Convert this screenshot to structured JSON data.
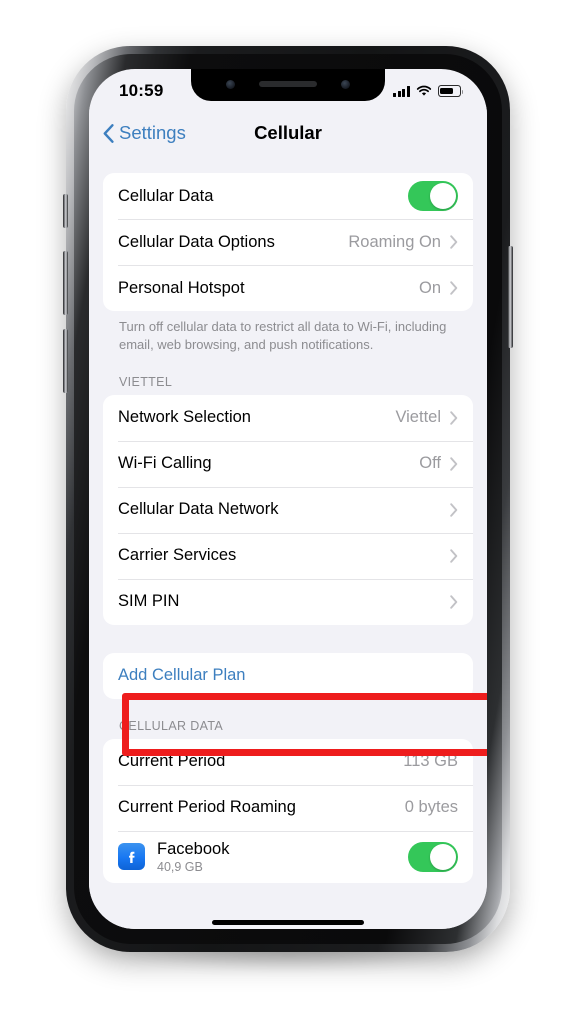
{
  "status_bar": {
    "time": "10:59",
    "signal_icon": "cellular-bars-icon",
    "wifi_icon": "wifi-icon",
    "battery_icon": "battery-icon",
    "battery_level_percent": 60
  },
  "nav": {
    "back_label": "Settings",
    "back_icon": "chevron-left-icon",
    "title": "Cellular"
  },
  "colors": {
    "accent_blue": "#3d7fbf",
    "toggle_green": "#34c759",
    "annotation_red": "#ee1d1d",
    "screen_background": "#f2f2f7",
    "card_background": "#ffffff",
    "secondary_text": "#8c8c90"
  },
  "sections": {
    "data_group": {
      "rows": [
        {
          "label": "Cellular Data",
          "control": "toggle",
          "toggle_on": true
        },
        {
          "label": "Cellular Data Options",
          "value": "Roaming On",
          "control": "chevron"
        },
        {
          "label": "Personal Hotspot",
          "value": "On",
          "control": "chevron"
        }
      ],
      "footnote": "Turn off cellular data to restrict all data to Wi-Fi, including email, web browsing, and push notifications."
    },
    "carrier_group": {
      "header": "VIETTEL",
      "rows": [
        {
          "label": "Network Selection",
          "value": "Viettel",
          "control": "chevron"
        },
        {
          "label": "Wi-Fi Calling",
          "value": "Off",
          "control": "chevron"
        },
        {
          "label": "Cellular Data Network",
          "value": "",
          "control": "chevron"
        },
        {
          "label": "Carrier Services",
          "value": "",
          "control": "chevron"
        },
        {
          "label": "SIM PIN",
          "value": "",
          "control": "chevron"
        }
      ]
    },
    "add_plan_group": {
      "label": "Add Cellular Plan",
      "highlighted": true
    },
    "cellular_data_group": {
      "header": "CELLULAR DATA",
      "rows": [
        {
          "label": "Current Period",
          "value": "113 GB"
        },
        {
          "label": "Current Period Roaming",
          "value": "0 bytes"
        }
      ],
      "apps": [
        {
          "name": "Facebook",
          "usage": "40,9 GB",
          "icon": "facebook-icon",
          "toggle_on": true
        }
      ]
    }
  }
}
